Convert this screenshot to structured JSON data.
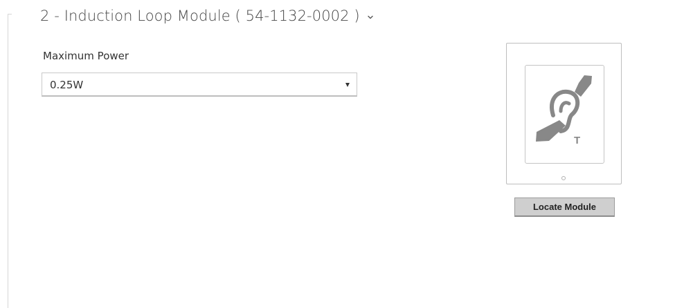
{
  "section": {
    "title": "2 - Induction Loop Module ( 54-1132-0002 )",
    "chevron_icon": "chevron-down-icon"
  },
  "max_power": {
    "label": "Maximum Power",
    "selected_value": "0.25W"
  },
  "module_preview": {
    "icon": "hearing-loop-t-icon",
    "icon_letter": "T",
    "locate_button_label": "Locate Module"
  },
  "colors": {
    "text": "#333333",
    "icon": "#888888",
    "button_bg": "#cfcfcf",
    "border": "#c9c9c9"
  }
}
